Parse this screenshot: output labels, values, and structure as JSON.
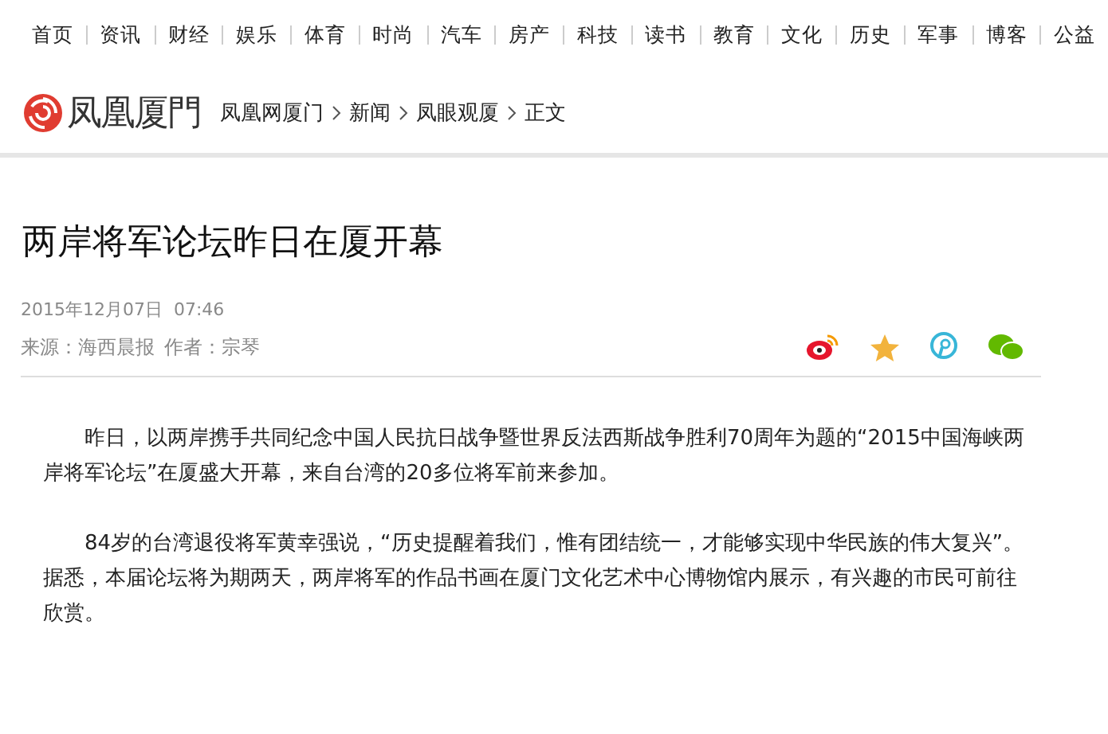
{
  "nav": [
    "首页",
    "资讯",
    "财经",
    "娱乐",
    "体育",
    "时尚",
    "汽车",
    "房产",
    "科技",
    "读书",
    "教育",
    "文化",
    "历史",
    "军事",
    "博客",
    "公益"
  ],
  "logo": "凤凰厦門",
  "breadcrumb": [
    "凤凰网厦门",
    "新闻",
    "凤眼观厦",
    "正文"
  ],
  "article": {
    "title": "两岸将军论坛昨日在厦开幕",
    "date": "2015年12月07日  07:46",
    "source": "来源：海西晨报",
    "author": "作者：宗琴",
    "paragraphs": [
      "昨日，以两岸携手共同纪念中国人民抗日战争暨世界反法西斯战争胜利70周年为题的“2015中国海峡两岸将军论坛”在厦盛大开幕，来自台湾的20多位将军前来参加。",
      "84岁的台湾退役将军黄幸强说，“历史提醒着我们，惟有团结统一，才能够实现中华民族的伟大复兴”。据悉，本届论坛将为期两天，两岸将军的作品书画在厦门文化艺术中心博物馆内展示，有兴趣的市民可前往欣赏。"
    ]
  }
}
